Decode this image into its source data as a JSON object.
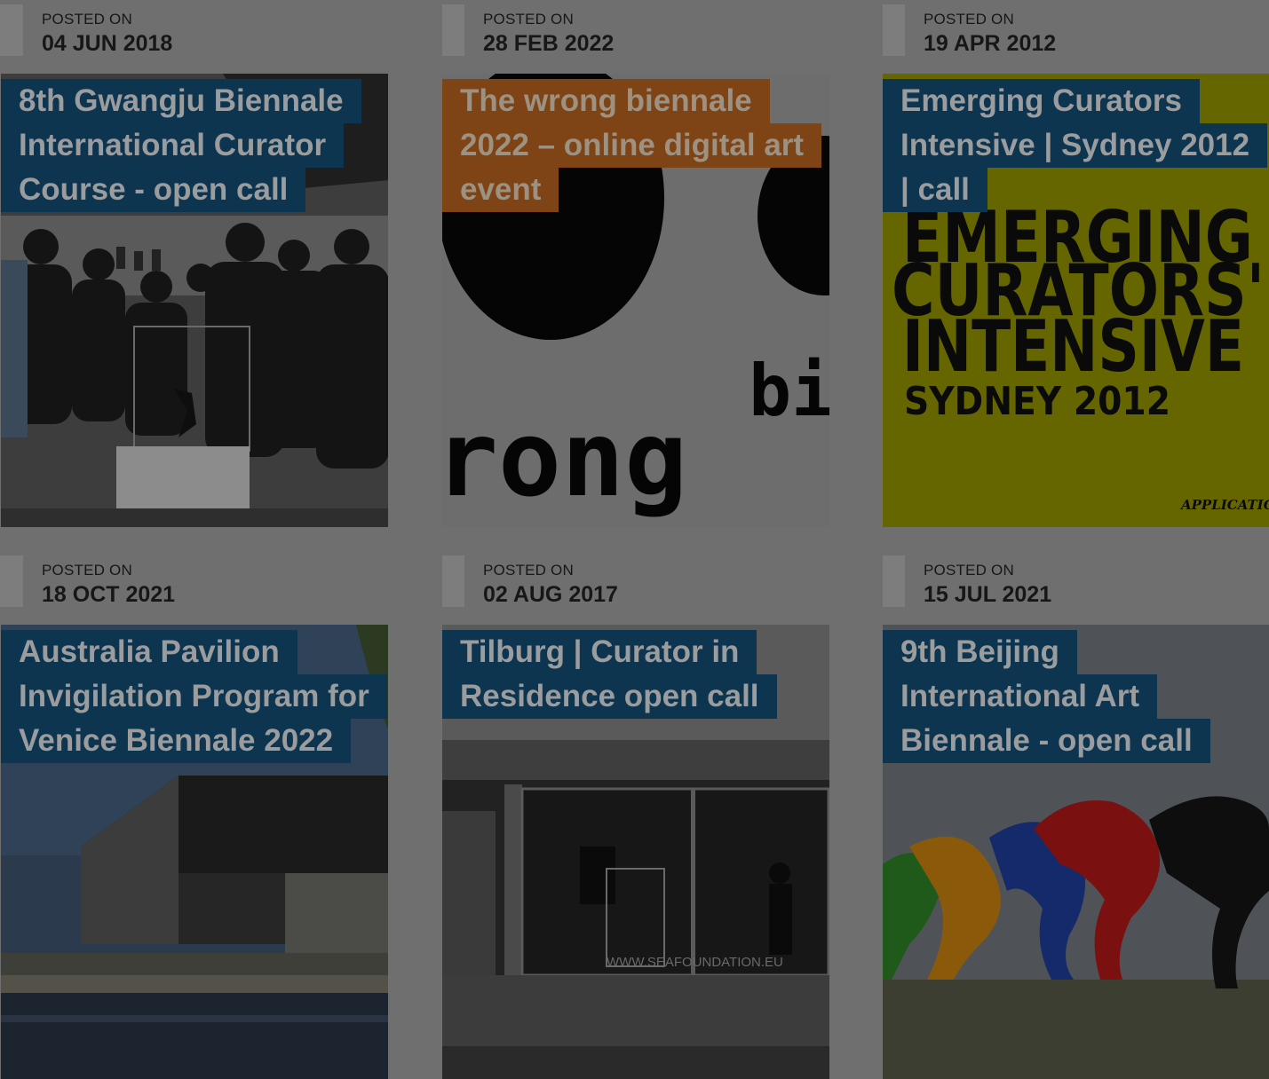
{
  "meta_label": "POSTED ON",
  "posts": [
    {
      "date": "04 JUN 2018",
      "title_lines": [
        "8th Gwangju Biennale",
        "International Curator",
        "Course - open call"
      ],
      "image": "gallery-visitors-photo"
    },
    {
      "date": "28 FEB 2022",
      "title_lines": [
        "The wrong biennale",
        "2022 – online digital art",
        "event"
      ],
      "image": "wrong-biennale-logo",
      "logo_text": "rong",
      "logo_sup": "bi"
    },
    {
      "date": "19 APR 2012",
      "title_lines": [
        "Emerging Curators",
        "Intensive | Sydney 2012",
        "| call"
      ],
      "image": "emerging-curators-poster",
      "poster_lines": [
        "EMERGING",
        "CURATORS'",
        "INTENSIVE"
      ],
      "poster_year": "SYDNEY 2012",
      "poster_corner": "APPLICATION"
    },
    {
      "date": "18 OCT 2021",
      "title_lines": [
        "Australia Pavilion",
        "Invigilation Program for",
        "Venice Biennale 2022"
      ],
      "image": "pavilion-building-photo"
    },
    {
      "date": "02 AUG 2017",
      "title_lines": [
        "Tilburg | Curator in",
        "Residence open call"
      ],
      "image": "storefront-photo",
      "window_text": "WWW.SEAFOUNDATION.EU"
    },
    {
      "date": "15 JUL 2021",
      "title_lines": [
        "9th Beijing",
        "International Art",
        "Biennale - open call"
      ],
      "image": "sculpture-photo"
    }
  ],
  "colors": {
    "overlay": "#6f6f6f",
    "title_bg": "#0d3550",
    "title_bg_brown": "#7e4416",
    "poster_yellow": "#cccc00"
  }
}
